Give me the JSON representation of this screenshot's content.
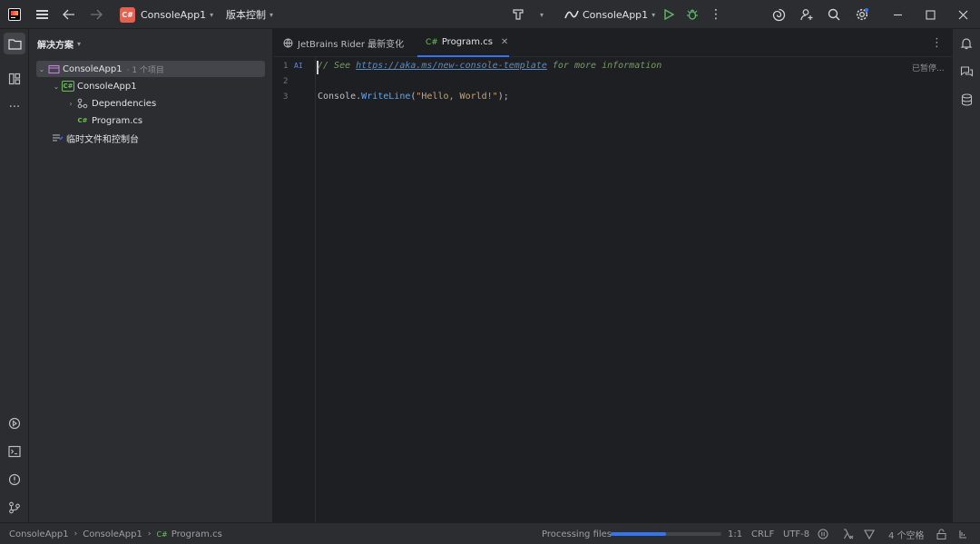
{
  "titlebar": {
    "project_badge": "C#",
    "project_name": "ConsoleApp1",
    "vcs_label": "版本控制",
    "run_config": "ConsoleApp1"
  },
  "project_panel": {
    "title": "解决方案",
    "tree": [
      {
        "label": "ConsoleApp1",
        "meta": "· 1 个项目"
      },
      {
        "label": "ConsoleApp1"
      },
      {
        "label": "Dependencies"
      },
      {
        "label": "Program.cs",
        "icon": "C#"
      },
      {
        "label": "临时文件和控制台"
      }
    ]
  },
  "editor": {
    "tabs": [
      {
        "label": "JetBrains Rider 最新变化"
      },
      {
        "label": "Program.cs",
        "icon": "C#"
      }
    ],
    "line_numbers": [
      "1",
      "2",
      "3"
    ],
    "ai_badge": "AI",
    "code": {
      "comment_prefix": "// See ",
      "comment_link": "https://aka.ms/new-console-template",
      "comment_suffix": " for more information",
      "line3_obj": "Console.",
      "line3_method": "WriteLine",
      "line3_open": "(",
      "line3_string": "\"Hello, World!\"",
      "line3_close": ");"
    },
    "inspection_text": "已暂停..."
  },
  "statusbar": {
    "breadcrumb": [
      "ConsoleApp1",
      "ConsoleApp1",
      "Program.cs"
    ],
    "breadcrumb_icon": "C#",
    "processing_label": "Processing files",
    "progress": 0.5,
    "position": "1:1",
    "line_ending": "CRLF",
    "encoding": "UTF-8",
    "indent": "4 个空格"
  },
  "colors": {
    "accent": "#3574f0",
    "project_badge": "#e2614f",
    "run_green": "#5fb865"
  }
}
